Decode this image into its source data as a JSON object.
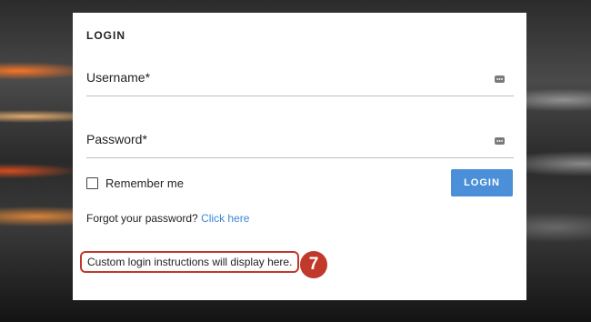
{
  "login_form": {
    "title": "LOGIN",
    "username_label": "Username*",
    "username_icon": "password-dots-icon",
    "password_label": "Password*",
    "password_icon": "password-dots-icon",
    "remember_label": "Remember me",
    "remember_checked": false,
    "login_button_label": "LOGIN",
    "forgot_text": "Forgot your password?",
    "forgot_link_text": "Click here",
    "custom_instructions": "Custom login instructions will display here.",
    "callout_number": "7"
  },
  "colors": {
    "button": "#4a8fd8",
    "link": "#3b87d8",
    "callout": "#c0392b"
  }
}
